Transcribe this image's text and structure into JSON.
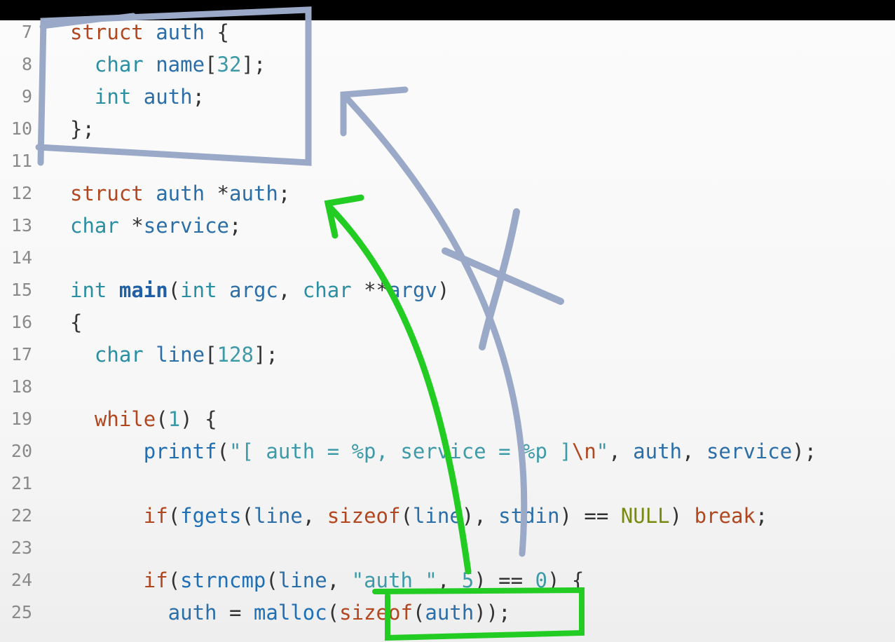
{
  "lines": [
    {
      "n": "7",
      "tokens": [
        [
          "struct",
          "k-struct"
        ],
        [
          " auth ",
          "ident"
        ],
        [
          "{",
          "punc"
        ]
      ]
    },
    {
      "n": "8",
      "tokens": [
        [
          "  char",
          "k-type"
        ],
        [
          " name",
          "ident"
        ],
        [
          "[",
          "punc"
        ],
        [
          "32",
          "num"
        ],
        [
          "];",
          "punc"
        ]
      ]
    },
    {
      "n": "9",
      "tokens": [
        [
          "  int",
          "k-type"
        ],
        [
          " auth",
          "ident"
        ],
        [
          ";",
          "punc"
        ]
      ]
    },
    {
      "n": "10",
      "tokens": [
        [
          "};",
          "punc"
        ]
      ]
    },
    {
      "n": "11",
      "tokens": []
    },
    {
      "n": "12",
      "tokens": [
        [
          "struct",
          "k-struct"
        ],
        [
          " auth ",
          "ident"
        ],
        [
          "*",
          "punc"
        ],
        [
          "auth",
          "ident"
        ],
        [
          ";",
          "punc"
        ]
      ]
    },
    {
      "n": "13",
      "tokens": [
        [
          "char",
          "k-type"
        ],
        [
          " *",
          "punc"
        ],
        [
          "service",
          "ident"
        ],
        [
          ";",
          "punc"
        ]
      ]
    },
    {
      "n": "14",
      "tokens": []
    },
    {
      "n": "15",
      "tokens": [
        [
          "int",
          "k-type"
        ],
        [
          " ",
          "punc"
        ],
        [
          "main",
          "fn-bold"
        ],
        [
          "(",
          "punc"
        ],
        [
          "int",
          "k-type"
        ],
        [
          " argc",
          "ident"
        ],
        [
          ", ",
          "punc"
        ],
        [
          "char",
          "k-type"
        ],
        [
          " **",
          "punc"
        ],
        [
          "argv",
          "ident"
        ],
        [
          ")",
          "punc"
        ]
      ]
    },
    {
      "n": "16",
      "tokens": [
        [
          "{",
          "punc"
        ]
      ]
    },
    {
      "n": "17",
      "tokens": [
        [
          "  char",
          "k-type"
        ],
        [
          " line",
          "ident"
        ],
        [
          "[",
          "punc"
        ],
        [
          "128",
          "num"
        ],
        [
          "];",
          "punc"
        ]
      ]
    },
    {
      "n": "18",
      "tokens": []
    },
    {
      "n": "19",
      "tokens": [
        [
          "  while",
          "kw"
        ],
        [
          "(",
          "punc"
        ],
        [
          "1",
          "num"
        ],
        [
          ") {",
          "punc"
        ]
      ]
    },
    {
      "n": "20",
      "tokens": [
        [
          "      printf",
          "fn"
        ],
        [
          "(",
          "punc"
        ],
        [
          "\"[ auth = %p, service = %p ]",
          "str"
        ],
        [
          "\\n",
          "esc"
        ],
        [
          "\"",
          "str"
        ],
        [
          ", ",
          "punc"
        ],
        [
          "auth",
          "ident"
        ],
        [
          ", ",
          "punc"
        ],
        [
          "service",
          "ident"
        ],
        [
          ");",
          "punc"
        ]
      ]
    },
    {
      "n": "21",
      "tokens": []
    },
    {
      "n": "22",
      "tokens": [
        [
          "      if",
          "kw"
        ],
        [
          "(",
          "punc"
        ],
        [
          "fgets",
          "fn"
        ],
        [
          "(",
          "punc"
        ],
        [
          "line",
          "ident"
        ],
        [
          ", ",
          "punc"
        ],
        [
          "sizeof",
          "kw"
        ],
        [
          "(",
          "punc"
        ],
        [
          "line",
          "ident"
        ],
        [
          "), ",
          "punc"
        ],
        [
          "stdin",
          "ident"
        ],
        [
          ") == ",
          "punc"
        ],
        [
          "NULL",
          "null"
        ],
        [
          ") ",
          "punc"
        ],
        [
          "break",
          "kw"
        ],
        [
          ";",
          "punc"
        ]
      ]
    },
    {
      "n": "23",
      "tokens": []
    },
    {
      "n": "24",
      "tokens": [
        [
          "      if",
          "kw"
        ],
        [
          "(",
          "punc"
        ],
        [
          "strncmp",
          "fn"
        ],
        [
          "(",
          "punc"
        ],
        [
          "line",
          "ident"
        ],
        [
          ", ",
          "punc"
        ],
        [
          "\"auth \"",
          "str"
        ],
        [
          ", ",
          "punc"
        ],
        [
          "5",
          "num"
        ],
        [
          ") == ",
          "punc"
        ],
        [
          "0",
          "num"
        ],
        [
          ") {",
          "punc"
        ]
      ]
    },
    {
      "n": "25",
      "tokens": [
        [
          "        auth",
          "ident"
        ],
        [
          " = ",
          "punc"
        ],
        [
          "malloc",
          "fn"
        ],
        [
          "(",
          "punc"
        ],
        [
          "sizeof",
          "kw"
        ],
        [
          "(",
          "punc"
        ],
        [
          "auth",
          "ident"
        ],
        [
          "));",
          "punc"
        ]
      ]
    }
  ],
  "annotation_colors": {
    "box": "#9aa9c8",
    "green": "#22cc22"
  }
}
